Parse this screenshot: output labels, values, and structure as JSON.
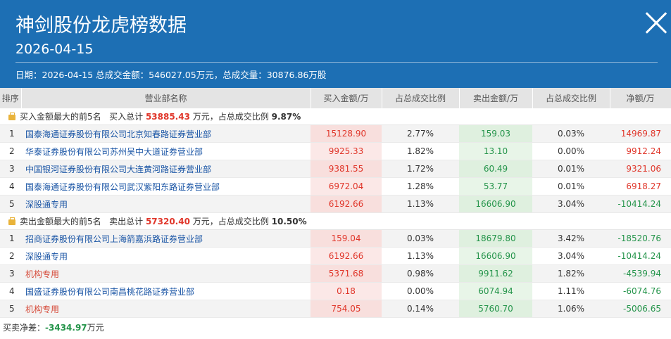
{
  "header": {
    "title": "神剑股份龙虎榜数据",
    "date": "2026-04-15",
    "summary": "日期：2026-04-15 总成交金额：546027.05万元，总成交量：30876.86万股"
  },
  "columns": [
    "排序",
    "营业部名称",
    "买入金额/万",
    "占总成交比例",
    "卖出金额/万",
    "占总成交比例",
    "净额/万"
  ],
  "buy_section": {
    "label": "买入金额最大的前5名",
    "total_label": "买入总计",
    "total": "53885.43",
    "unit_label": "万元，占总成交比例",
    "ratio": "9.87%",
    "rows": [
      {
        "idx": "1",
        "name": "国泰海通证券股份有限公司北京知春路证券营业部",
        "buy": "15128.90",
        "buy_pct": "2.77%",
        "sell": "159.03",
        "sell_pct": "0.03%",
        "net": "14969.87",
        "net_sign": "pos",
        "inst": false
      },
      {
        "idx": "2",
        "name": "华泰证券股份有限公司苏州吴中大道证券营业部",
        "buy": "9925.33",
        "buy_pct": "1.82%",
        "sell": "13.10",
        "sell_pct": "0.00%",
        "net": "9912.24",
        "net_sign": "pos",
        "inst": false
      },
      {
        "idx": "3",
        "name": "中国银河证券股份有限公司大连黄河路证券营业部",
        "buy": "9381.55",
        "buy_pct": "1.72%",
        "sell": "60.49",
        "sell_pct": "0.01%",
        "net": "9321.06",
        "net_sign": "pos",
        "inst": false
      },
      {
        "idx": "4",
        "name": "国泰海通证券股份有限公司武汉紫阳东路证券营业部",
        "buy": "6972.04",
        "buy_pct": "1.28%",
        "sell": "53.77",
        "sell_pct": "0.01%",
        "net": "6918.27",
        "net_sign": "pos",
        "inst": false
      },
      {
        "idx": "5",
        "name": "深股通专用",
        "buy": "6192.66",
        "buy_pct": "1.13%",
        "sell": "16606.90",
        "sell_pct": "3.04%",
        "net": "-10414.24",
        "net_sign": "neg",
        "inst": false
      }
    ]
  },
  "sell_section": {
    "label": "卖出金额最大的前5名",
    "total_label": "卖出总计",
    "total": "57320.40",
    "unit_label": "万元，占总成交比例",
    "ratio": "10.50%",
    "rows": [
      {
        "idx": "1",
        "name": "招商证券股份有限公司上海箭嘉浜路证券营业部",
        "buy": "159.04",
        "buy_pct": "0.03%",
        "sell": "18679.80",
        "sell_pct": "3.42%",
        "net": "-18520.76",
        "net_sign": "neg",
        "inst": false
      },
      {
        "idx": "2",
        "name": "深股通专用",
        "buy": "6192.66",
        "buy_pct": "1.13%",
        "sell": "16606.90",
        "sell_pct": "3.04%",
        "net": "-10414.24",
        "net_sign": "neg",
        "inst": false
      },
      {
        "idx": "3",
        "name": "机构专用",
        "buy": "5371.68",
        "buy_pct": "0.98%",
        "sell": "9911.62",
        "sell_pct": "1.82%",
        "net": "-4539.94",
        "net_sign": "neg",
        "inst": true
      },
      {
        "idx": "4",
        "name": "国盛证券股份有限公司南昌桃花路证券营业部",
        "buy": "0.18",
        "buy_pct": "0.00%",
        "sell": "6074.94",
        "sell_pct": "1.11%",
        "net": "-6074.76",
        "net_sign": "neg",
        "inst": false
      },
      {
        "idx": "5",
        "name": "机构专用",
        "buy": "754.05",
        "buy_pct": "0.14%",
        "sell": "5760.70",
        "sell_pct": "1.06%",
        "net": "-5006.65",
        "net_sign": "neg",
        "inst": true
      }
    ]
  },
  "footer": {
    "label": "买卖净差：",
    "value": "-3434.97",
    "unit": "万元"
  }
}
